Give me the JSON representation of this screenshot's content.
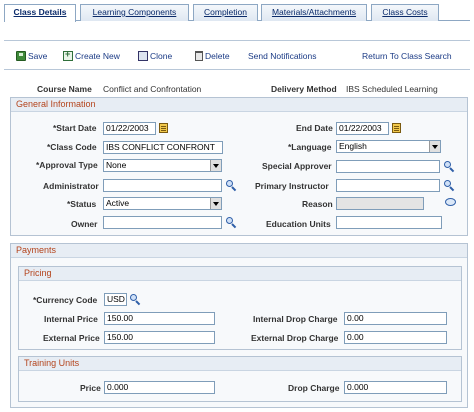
{
  "tabs": [
    {
      "label": "Class Details",
      "active": true
    },
    {
      "label": "Learning Components",
      "active": false
    },
    {
      "label": "Completion",
      "active": false
    },
    {
      "label": "Materials/Attachments",
      "active": false
    },
    {
      "label": "Class Costs",
      "active": false
    }
  ],
  "toolbar": {
    "save": "Save",
    "create_new": "Create New",
    "clone": "Clone",
    "delete": "Delete",
    "send_notifications": "Send Notifications",
    "return": "Return To Class Search"
  },
  "summary": {
    "course_name_label": "Course Name",
    "course_name_value": "Conflict and Confrontation",
    "delivery_method_label": "Delivery Method",
    "delivery_method_value": "IBS Scheduled Learning"
  },
  "general": {
    "title": "General Information",
    "start_date_label": "*Start Date",
    "start_date": "01/22/2003",
    "end_date_label": "End Date",
    "end_date": "01/22/2003",
    "class_code_label": "*Class Code",
    "class_code": "IBS CONFLICT CONFRONT",
    "language_label": "*Language",
    "language": "English",
    "approval_type_label": "*Approval Type",
    "approval_type": "None",
    "special_approver_label": "Special Approver",
    "special_approver": "",
    "administrator_label": "Administrator",
    "administrator": "",
    "primary_instructor_label": "Primary Instructor",
    "primary_instructor": "",
    "status_label": "*Status",
    "status": "Active",
    "reason_label": "Reason",
    "reason": "",
    "owner_label": "Owner",
    "owner": "",
    "education_units_label": "Education Units",
    "education_units": ""
  },
  "payments": {
    "title": "Payments",
    "pricing": {
      "title": "Pricing",
      "currency_code_label": "*Currency Code",
      "currency_code": "USD",
      "internal_price_label": "Internal Price",
      "internal_price": "150.00",
      "internal_drop_charge_label": "Internal Drop Charge",
      "internal_drop_charge": "0.00",
      "external_price_label": "External Price",
      "external_price": "150.00",
      "external_drop_charge_label": "External Drop Charge",
      "external_drop_charge": "0.00"
    },
    "training_units": {
      "title": "Training Units",
      "price_label": "Price",
      "price": "0.000",
      "drop_charge_label": "Drop Charge",
      "drop_charge": "0.000"
    }
  },
  "colors": {
    "section_title": "#b4441c",
    "link": "#1a3a85",
    "border": "#b5c3d3"
  }
}
